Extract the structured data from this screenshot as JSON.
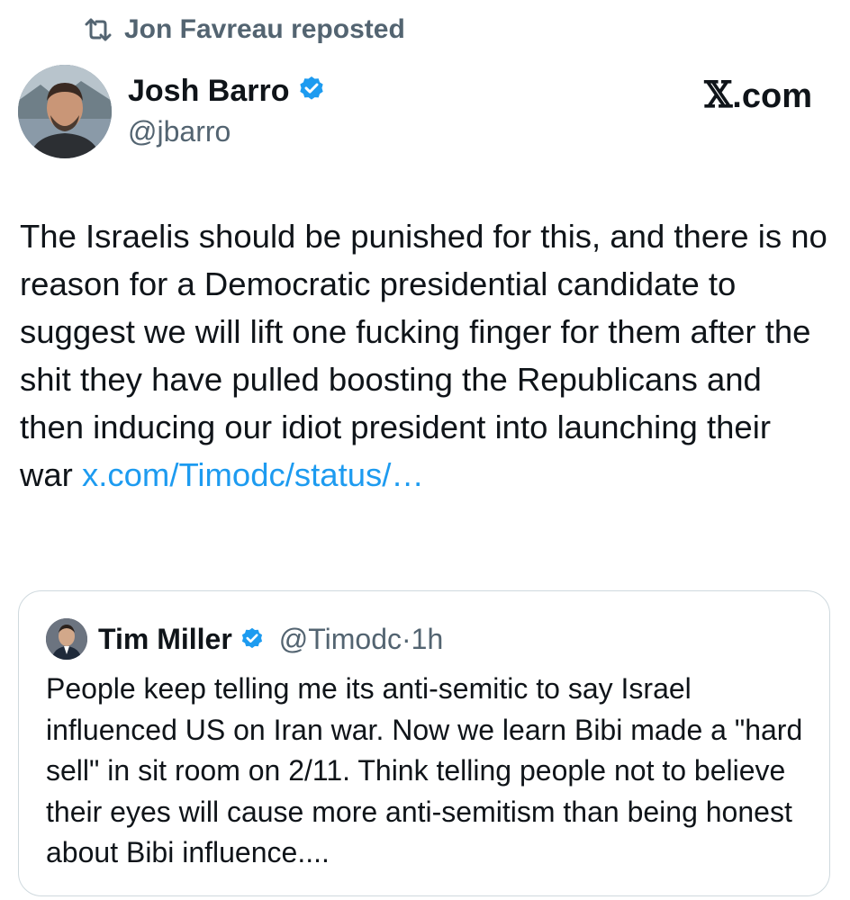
{
  "repost": {
    "label": "Jon Favreau reposted"
  },
  "author": {
    "name": "Josh Barro",
    "handle": "@jbarro",
    "verified": true
  },
  "brand": {
    "x_glyph": "𝕏",
    "suffix": ".com"
  },
  "tweet": {
    "text": "The Israelis should be punished for this, and there is no reason for a Democratic presidential candidate to suggest we will lift one fucking finger for them after the shit they have pulled boosting the Republicans and then inducing our idiot president into launching their war ",
    "link": "x.com/Timodc/status/…"
  },
  "quote": {
    "name": "Tim Miller",
    "handle": "@Timodc",
    "separator": "·",
    "time": "1h",
    "verified": true,
    "text": "People keep telling me its anti-semitic to say Israel influenced US on Iran war. Now we learn Bibi made a \"hard sell\" in sit room on 2/11. Think telling people not to believe their eyes will cause more anti-semitism than being honest about Bibi influence...."
  },
  "colors": {
    "link": "#1d9bf0",
    "verified_badge": "#1d9bf0",
    "secondary_text": "#536471",
    "card_border": "#cfd9de"
  },
  "icons": [
    "repost-icon",
    "verified-badge-icon",
    "x-logo-icon"
  ]
}
